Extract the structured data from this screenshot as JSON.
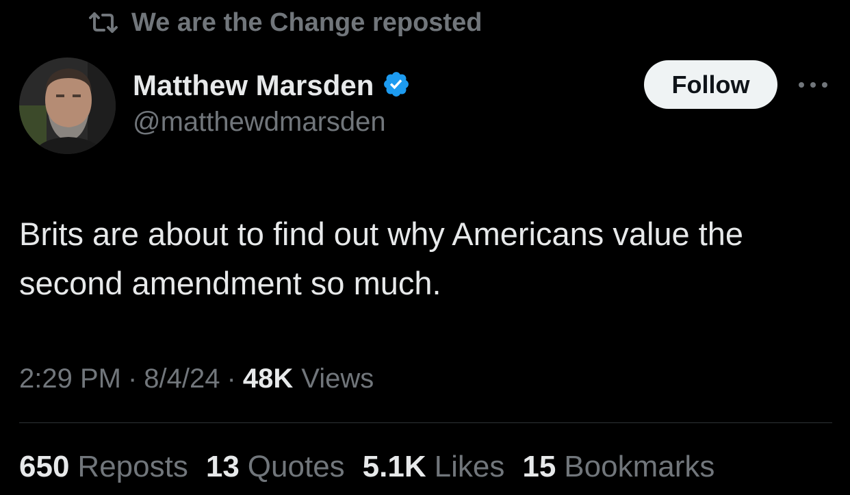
{
  "repost_context": {
    "text": "We are the Change reposted",
    "icon": "repost-icon"
  },
  "author": {
    "display_name": "Matthew Marsden",
    "handle": "@matthewdmarsden",
    "verified": true,
    "verified_icon": "verified-badge-icon",
    "verified_color": "#1d9bf0"
  },
  "actions": {
    "follow_label": "Follow",
    "more_icon": "more-options-icon"
  },
  "tweet": {
    "text": "Brits are about to find out why Americans value the second amendment so much."
  },
  "meta": {
    "time": "2:29 PM",
    "separator": "·",
    "date": "8/4/24",
    "views_count": "48K",
    "views_label": "Views"
  },
  "stats": [
    {
      "count": "650",
      "label": "Reposts"
    },
    {
      "count": "13",
      "label": "Quotes"
    },
    {
      "count": "5.1K",
      "label": "Likes"
    },
    {
      "count": "15",
      "label": "Bookmarks"
    }
  ],
  "colors": {
    "background": "#000000",
    "primary_text": "#e7e9ea",
    "secondary_text": "#71767b",
    "follow_button_bg": "#eff3f4",
    "divider": "#2f3336"
  }
}
